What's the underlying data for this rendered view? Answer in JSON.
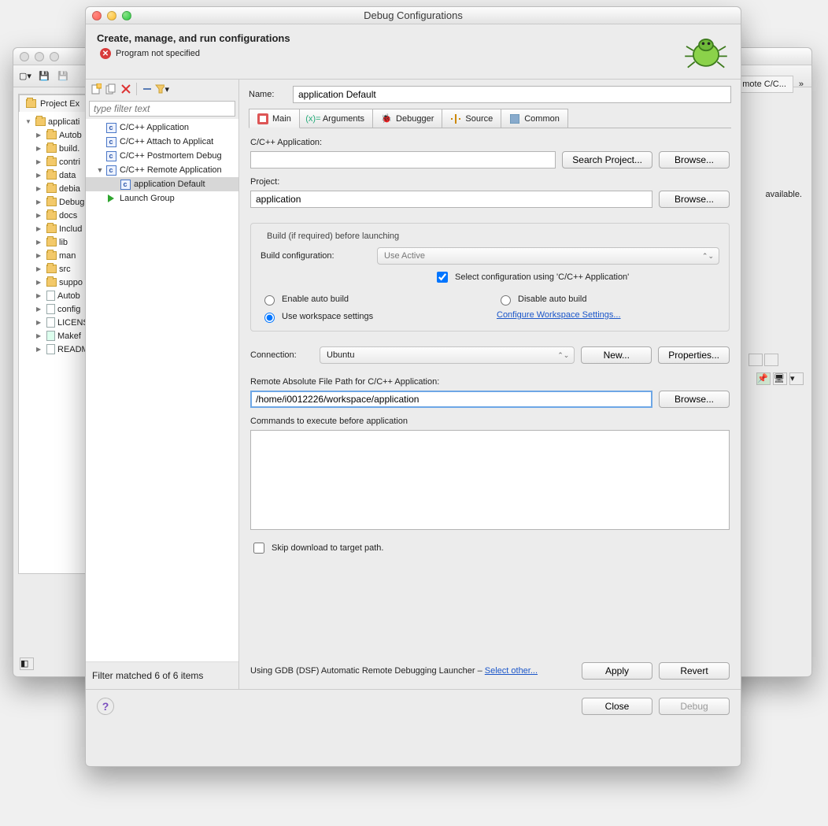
{
  "dialog": {
    "title": "Debug Configurations",
    "header": "Create, manage, and run configurations",
    "error": "Program not specified",
    "name_label": "Name:",
    "name_value": "application Default",
    "filter_placeholder": "type filter text",
    "filter_status": "Filter matched 6 of 6 items",
    "tree": {
      "items": [
        {
          "label": "C/C++ Application"
        },
        {
          "label": "C/C++ Attach to Applicat"
        },
        {
          "label": "C/C++ Postmortem Debug"
        },
        {
          "label": "C/C++ Remote Application",
          "expanded": true
        },
        {
          "label": "application Default",
          "selected": true
        },
        {
          "label": "Launch Group",
          "launch": true
        }
      ]
    },
    "tabs": [
      "Main",
      "Arguments",
      "Debugger",
      "Source",
      "Common"
    ],
    "main": {
      "app_label": "C/C++ Application:",
      "app_value": "",
      "search_project": "Search Project...",
      "browse": "Browse...",
      "project_label": "Project:",
      "project_value": "application",
      "build_legend": "Build (if required) before launching",
      "build_config_label": "Build configuration:",
      "build_config_value": "Use Active",
      "select_config_chk": "Select configuration using 'C/C++ Application'",
      "enable_auto": "Enable auto build",
      "disable_auto": "Disable auto build",
      "use_workspace": "Use workspace settings",
      "configure_ws": "Configure Workspace Settings...",
      "connection_label": "Connection:",
      "connection_value": "Ubuntu",
      "new_btn": "New...",
      "properties_btn": "Properties...",
      "remote_path_label": "Remote Absolute File Path for C/C++ Application:",
      "remote_path_value": "/home/i0012226/workspace/application",
      "commands_label": "Commands to execute before application",
      "commands_value": "",
      "skip_download": "Skip download to target path."
    },
    "launcher": {
      "text_prefix": "Using GDB (DSF) Automatic Remote Debugging Launcher – ",
      "link": "Select other..."
    },
    "buttons": {
      "apply": "Apply",
      "revert": "Revert",
      "close": "Close",
      "debug": "Debug"
    }
  },
  "bg": {
    "remote_tab": "mote C/C...",
    "project_explorer": "Project Ex",
    "no_consoles": "available.",
    "tree": [
      "applicati",
      "Autob",
      "build.",
      "contri",
      "data",
      "debia",
      "Debug",
      "docs",
      "Includ",
      "lib",
      "man",
      "src",
      "suppo",
      "Autob",
      "config",
      "LICENS",
      "Makef",
      "READM"
    ]
  }
}
